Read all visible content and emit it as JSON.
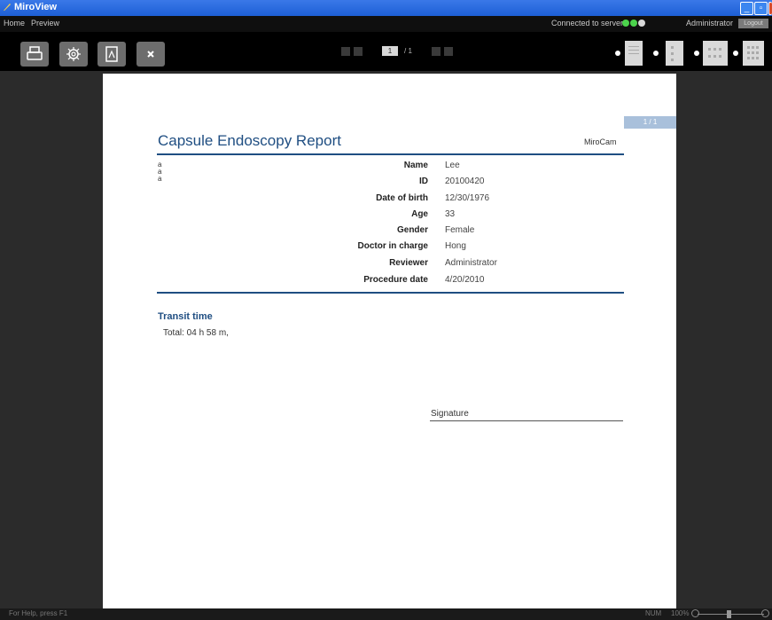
{
  "app": {
    "title": "MiroView"
  },
  "menu": {
    "home": "Home",
    "preview": "Preview"
  },
  "status": {
    "server": "Connected to server",
    "user": "Administrator",
    "logout": "Logout"
  },
  "toolbar": {
    "page_current": "1",
    "page_total": "/ 1"
  },
  "report": {
    "page_tag": "1 / 1",
    "title": "Capsule Endoscopy Report",
    "brand": "MiroCam",
    "letters": [
      "a",
      "a",
      "a"
    ],
    "fields": [
      {
        "label": "Name",
        "value": "Lee"
      },
      {
        "label": "ID",
        "value": "20100420"
      },
      {
        "label": "Date of birth",
        "value": "12/30/1976"
      },
      {
        "label": "Age",
        "value": "33"
      },
      {
        "label": "Gender",
        "value": "Female"
      },
      {
        "label": "Doctor in charge",
        "value": "Hong"
      },
      {
        "label": "Reviewer",
        "value": "Administrator"
      },
      {
        "label": "Procedure date",
        "value": "4/20/2010"
      }
    ],
    "transit_title": "Transit time",
    "transit_total": "Total: 04 h  58 m,",
    "signature_label": "Signature"
  },
  "statusbar": {
    "help": "For Help, press F1",
    "num": "NUM",
    "zoom": "100%"
  },
  "colors": {
    "accent": "#1f4e82",
    "titlebar": "#1d5fd6",
    "page_tag": "#a9c0db"
  }
}
